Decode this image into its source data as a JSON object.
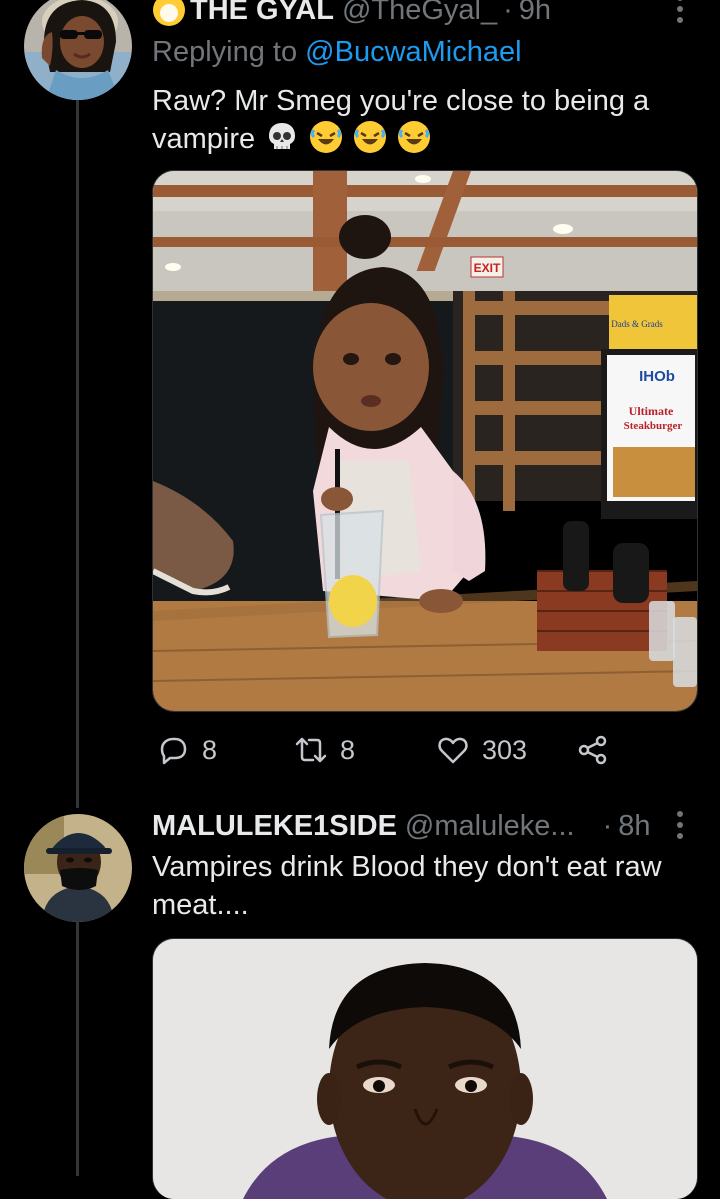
{
  "tweet1": {
    "emoji_prefix": "😍",
    "display_name": "THE GYAL",
    "handle": "@TheGyal_",
    "dot": "·",
    "time": "9h",
    "replying_prefix": "Replying to",
    "replying_to": "@BucwaMichael",
    "text": "Raw? Mr Smeg you're close to being a vampire",
    "emojis": [
      "skull",
      "rofl",
      "rofl",
      "rofl"
    ],
    "image_signs": {
      "exit": "EXIT",
      "brand": "IHOb",
      "promo_line1": "Ultimate",
      "promo_line2": "Steakburger",
      "box_text": "Dads & Grads"
    },
    "actions": {
      "replies": "8",
      "retweets": "8",
      "likes": "303"
    }
  },
  "tweet2": {
    "display_name": "MALULEKE1SIDE",
    "handle": "@maluleke...",
    "dot": "·",
    "time": "8h",
    "text": "Vampires drink Blood they don't eat raw meat...."
  },
  "colors": {
    "background": "#000000",
    "primary_text": "#e7e9ea",
    "secondary_text": "#71767b",
    "link": "#1d9bf0",
    "thread_line": "#333639"
  }
}
